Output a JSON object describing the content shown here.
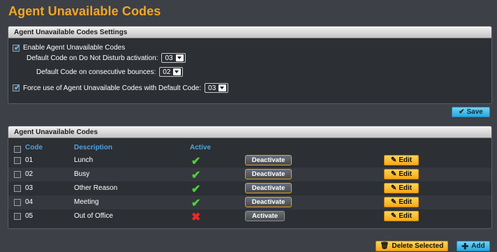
{
  "page": {
    "title": "Agent Unavailable Codes"
  },
  "settings": {
    "header": "Agent Unavailable Codes Settings",
    "enable_label": "Enable Agent Unavailable Codes",
    "enable_checked": true,
    "dnd_label": "Default Code on Do Not Disturb activation:",
    "dnd_value": "03",
    "bounces_label": "Default Code on consecutive bounces:",
    "bounces_value": "02",
    "force_label": "Force use of Agent Unavailable Codes with Default Code:",
    "force_checked": true,
    "force_value": "03",
    "save_label": "Save"
  },
  "codes": {
    "header": "Agent Unavailable Codes",
    "columns": {
      "code": "Code",
      "description": "Description",
      "active": "Active"
    },
    "rows": [
      {
        "code": "01",
        "description": "Lunch",
        "active": true,
        "toggle_label": "Deactivate",
        "edit_label": "Edit"
      },
      {
        "code": "02",
        "description": "Busy",
        "active": true,
        "toggle_label": "Deactivate",
        "edit_label": "Edit"
      },
      {
        "code": "03",
        "description": "Other Reason",
        "active": true,
        "toggle_label": "Deactivate",
        "edit_label": "Edit"
      },
      {
        "code": "04",
        "description": "Meeting",
        "active": true,
        "toggle_label": "Deactivate",
        "edit_label": "Edit"
      },
      {
        "code": "05",
        "description": "Out of Office",
        "active": false,
        "toggle_label": "Activate",
        "edit_label": "Edit"
      }
    ],
    "delete_label": "Delete Selected",
    "add_label": "Add"
  },
  "icons": {
    "active": "check-icon",
    "inactive": "x-icon",
    "edit": "pencil-icon",
    "delete": "trash-icon",
    "add": "plus-icon",
    "save": "check-icon"
  },
  "colors": {
    "title": "#f5a623",
    "column_header": "#4da3e0",
    "active_check": "#4cd137",
    "inactive_x": "#e82a2a",
    "primary_button": "#2ba6db",
    "edit_button": "#f5a81c"
  }
}
